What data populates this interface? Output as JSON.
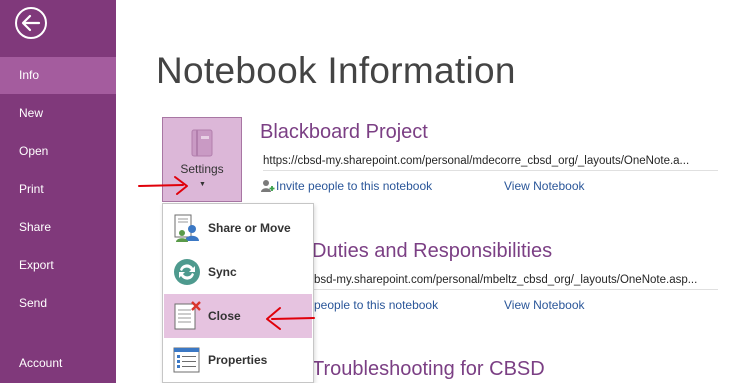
{
  "sidebar": {
    "items": [
      {
        "label": "Info"
      },
      {
        "label": "New"
      },
      {
        "label": "Open"
      },
      {
        "label": "Print"
      },
      {
        "label": "Share"
      },
      {
        "label": "Export"
      },
      {
        "label": "Send"
      },
      {
        "label": "Account"
      }
    ],
    "active": "Info"
  },
  "main": {
    "title": "Notebook Information",
    "notebooks": [
      {
        "title": "Blackboard Project",
        "url": "https://cbsd-my.sharepoint.com/personal/mdecorre_cbsd_org/_layouts/OneNote.a...",
        "invite_label": "Invite people to this notebook",
        "view_label": "View Notebook"
      },
      {
        "title": "Duties and Responsibilities",
        "url": "bsd-my.sharepoint.com/personal/mbeltz_cbsd_org/_layouts/OneNote.asp...",
        "invite_label": "people to this notebook",
        "view_label": "View Notebook"
      },
      {
        "title": "Troubleshooting for CBSD"
      }
    ]
  },
  "settings": {
    "label": "Settings",
    "menu": [
      {
        "label": "Share or Move",
        "icon": "share-or-move-icon"
      },
      {
        "label": "Sync",
        "icon": "sync-icon"
      },
      {
        "label": "Close",
        "icon": "close-notebook-icon"
      },
      {
        "label": "Properties",
        "icon": "properties-icon"
      }
    ]
  },
  "colors": {
    "sidebar": "#80397b",
    "sidebar_active": "#a45c9e",
    "accent_text": "#7b3f84",
    "link": "#2a5699",
    "highlight": "#e6c3e0",
    "annotation": "#e0000a"
  }
}
